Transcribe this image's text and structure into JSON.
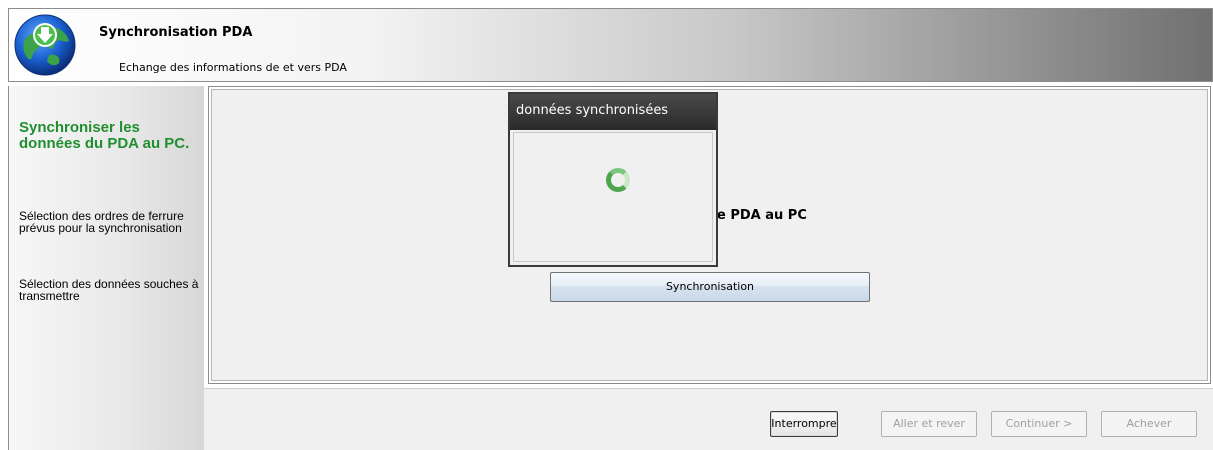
{
  "header": {
    "title": "Synchronisation PDA",
    "subtitle": "Echange des informations de et vers PDA",
    "icon": "globe-download-icon"
  },
  "sidebar": {
    "title": "Synchroniser les données du PDA au PC.",
    "items": [
      {
        "label": "Sélection des ordres de ferrure prévus pour la synchronisation"
      },
      {
        "label": "Sélection des données souches à transmettre"
      }
    ]
  },
  "main": {
    "heading_visible": "e PDA au PC",
    "sync_button_label": "Synchronisation"
  },
  "popup": {
    "title": "données synchronisées",
    "icon": "loading-spinner-icon"
  },
  "footer": {
    "buttons": [
      {
        "label": "Interrompre",
        "enabled": true
      },
      {
        "label": "Aller et rever",
        "enabled": false
      },
      {
        "label": "Continuer >",
        "enabled": false
      },
      {
        "label": "Achever",
        "enabled": false
      }
    ]
  },
  "colors": {
    "accent_green": "#1f8f2f",
    "popup_title_bg": "#2a2a2a"
  }
}
